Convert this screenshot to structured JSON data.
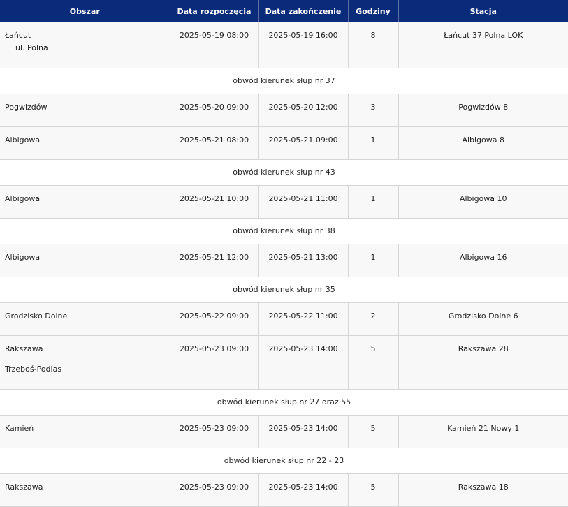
{
  "headers": {
    "area": "Obszar",
    "start": "Data rozpoczęcia",
    "end": "Data zakończenie",
    "hours": "Godziny",
    "station": "Stacja"
  },
  "rows": [
    {
      "area": "Łańcut",
      "area_sub": "ul. Polna",
      "start": "2025-05-19 08:00",
      "end": "2025-05-19 16:00",
      "hours": "8",
      "station": "Łańcut 37 Polna LOK",
      "note": "obwód kierunek słup nr 37"
    },
    {
      "area": "Pogwizdów",
      "start": "2025-05-20 09:00",
      "end": "2025-05-20 12:00",
      "hours": "3",
      "station": "Pogwizdów 8"
    },
    {
      "area": "Albigowa",
      "start": "2025-05-21 08:00",
      "end": "2025-05-21 09:00",
      "hours": "1",
      "station": "Albigowa 8",
      "note": "obwód kierunek słup nr 43"
    },
    {
      "area": "Albigowa",
      "start": "2025-05-21 10:00",
      "end": "2025-05-21 11:00",
      "hours": "1",
      "station": "Albigowa 10",
      "note": "obwód kierunek słup nr 38"
    },
    {
      "area": "Albigowa",
      "start": "2025-05-21 12:00",
      "end": "2025-05-21 13:00",
      "hours": "1",
      "station": "Albigowa 16",
      "note": "obwód kierunek słup nr 35"
    },
    {
      "area": "Grodzisko Dolne",
      "start": "2025-05-22 09:00",
      "end": "2025-05-22 11:00",
      "hours": "2",
      "station": "Grodzisko Dolne 6"
    },
    {
      "area": "Rakszawa",
      "area_second": "Trzeboś-Podlas",
      "start": "2025-05-23 09:00",
      "end": "2025-05-23 14:00",
      "hours": "5",
      "station": "Rakszawa 28",
      "note": "obwód kierunek słup nr 27 oraz 55"
    },
    {
      "area": "Kamień",
      "start": "2025-05-23 09:00",
      "end": "2025-05-23 14:00",
      "hours": "5",
      "station": "Kamień 21 Nowy 1",
      "note": "obwód kierunek słup nr 22 - 23"
    },
    {
      "area": "Rakszawa",
      "start": "2025-05-23 09:00",
      "end": "2025-05-23 14:00",
      "hours": "5",
      "station": "Rakszawa 18"
    }
  ]
}
